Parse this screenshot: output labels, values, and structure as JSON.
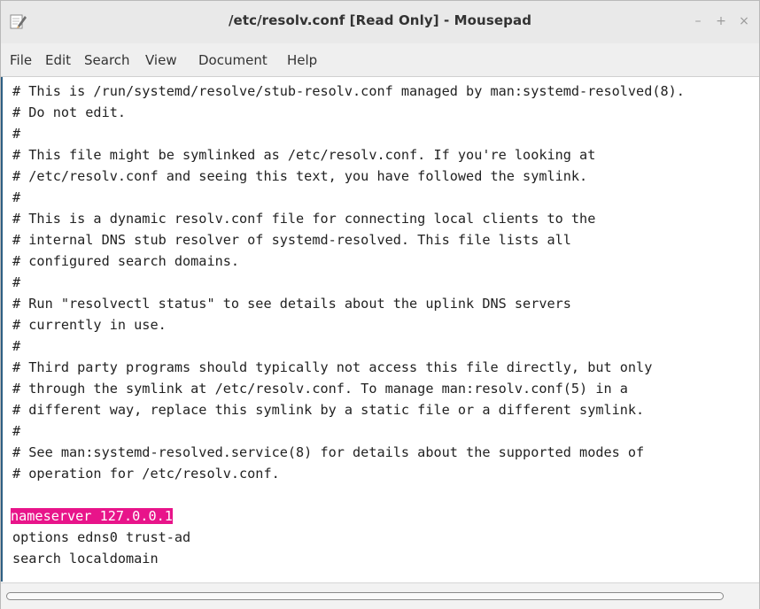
{
  "window": {
    "title": "/etc/resolv.conf [Read Only] - Mousepad",
    "icon": "mousepad-app-icon",
    "controls": {
      "minimize": "–",
      "maximize": "+",
      "close": "×"
    }
  },
  "menubar": {
    "items": [
      "File",
      "Edit",
      "Search",
      "View",
      "Document",
      "Help"
    ]
  },
  "editor": {
    "lines": [
      "# This is /run/systemd/resolve/stub-resolv.conf managed by man:systemd-resolved(8).",
      "# Do not edit.",
      "#",
      "# This file might be symlinked as /etc/resolv.conf. If you're looking at",
      "# /etc/resolv.conf and seeing this text, you have followed the symlink.",
      "#",
      "# This is a dynamic resolv.conf file for connecting local clients to the",
      "# internal DNS stub resolver of systemd-resolved. This file lists all",
      "# configured search domains.",
      "#",
      "# Run \"resolvectl status\" to see details about the uplink DNS servers",
      "# currently in use.",
      "#",
      "# Third party programs should typically not access this file directly, but only",
      "# through the symlink at /etc/resolv.conf. To manage man:resolv.conf(5) in a",
      "# different way, replace this symlink by a static file or a different symlink.",
      "#",
      "# See man:systemd-resolved.service(8) for details about the supported modes of",
      "# operation for /etc/resolv.conf.",
      "",
      "nameserver 127.0.0.1",
      "options edns0 trust-ad",
      "search localdomain"
    ],
    "highlight_color": "#e8148a"
  }
}
